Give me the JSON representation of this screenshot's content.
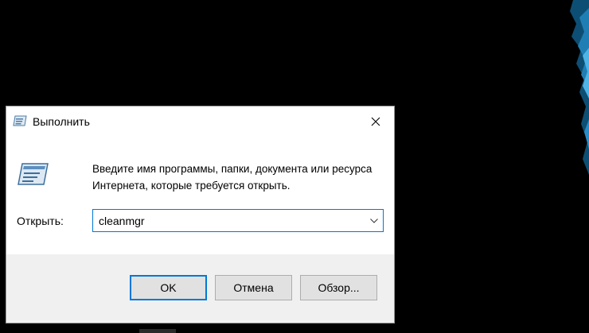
{
  "dialog": {
    "title": "Выполнить",
    "description": "Введите имя программы, папки, документа или ресурса Интернета, которые требуется открыть.",
    "open_label": "Открыть:",
    "command_value": "cleanmgr",
    "buttons": {
      "ok": "OK",
      "cancel": "Отмена",
      "browse": "Обзор..."
    }
  },
  "icons": {
    "title": "run-icon",
    "close": "close-icon",
    "dropdown": "chevron-down-icon",
    "large": "run-program-icon"
  },
  "colors": {
    "accent": "#0078d7",
    "footer_bg": "#f0f0f0",
    "button_bg": "#e1e1e1",
    "desktop_bg": "#000000"
  }
}
